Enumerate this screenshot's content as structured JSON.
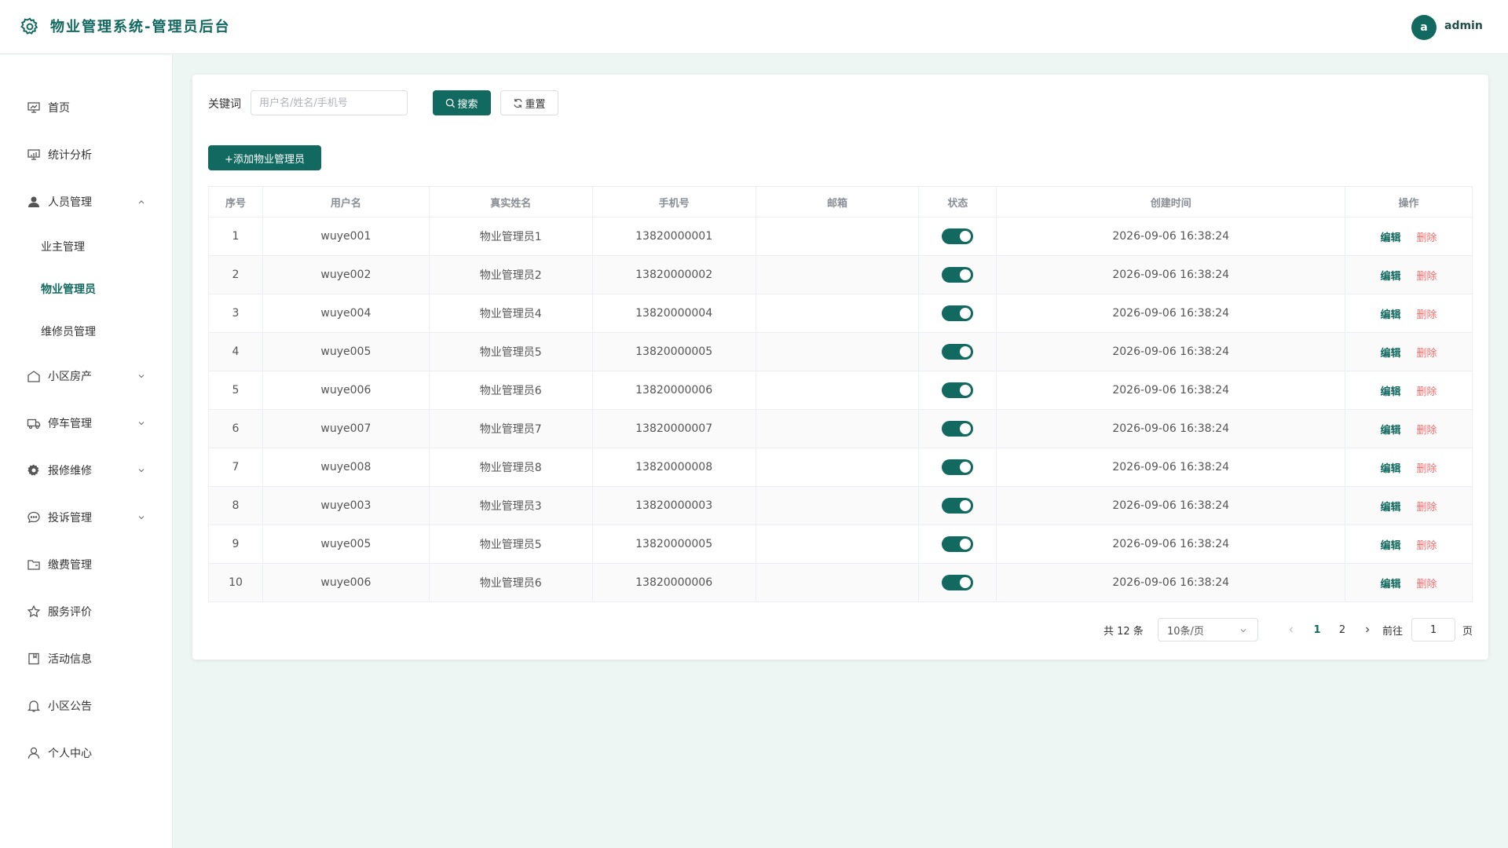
{
  "header": {
    "title": "物业管理系统-管理员后台",
    "avatar_letter": "a",
    "username": "admin"
  },
  "sidebar": {
    "items": [
      {
        "label": "首页",
        "icon": "dashboard-icon"
      },
      {
        "label": "统计分析",
        "icon": "chart-icon"
      },
      {
        "label": "人员管理",
        "icon": "user-filled-icon",
        "expanded": true,
        "children": [
          {
            "label": "业主管理"
          },
          {
            "label": "物业管理员",
            "active": true
          },
          {
            "label": "维修员管理"
          }
        ]
      },
      {
        "label": "小区房产",
        "icon": "house-icon"
      },
      {
        "label": "停车管理",
        "icon": "truck-icon"
      },
      {
        "label": "报修维修",
        "icon": "gear-icon"
      },
      {
        "label": "投诉管理",
        "icon": "chat-icon"
      },
      {
        "label": "缴费管理",
        "icon": "folder-icon"
      },
      {
        "label": "服务评价",
        "icon": "star-icon"
      },
      {
        "label": "活动信息",
        "icon": "notebook-icon"
      },
      {
        "label": "小区公告",
        "icon": "bell-icon"
      },
      {
        "label": "个人中心",
        "icon": "user-icon"
      }
    ]
  },
  "search": {
    "label": "关键词",
    "placeholder": "用户名/姓名/手机号",
    "value": "",
    "search_label": "搜索",
    "reset_label": "重置"
  },
  "toolbar": {
    "add_label": "+添加物业管理员"
  },
  "table": {
    "columns": [
      "序号",
      "用户名",
      "真实姓名",
      "手机号",
      "邮箱",
      "状态",
      "创建时间",
      "操作"
    ],
    "edit_label": "编辑",
    "delete_label": "删除",
    "rows": [
      {
        "no": "1",
        "username": "wuye001",
        "realname": "物业管理员1",
        "phone": "13820000001",
        "email": "",
        "enabled": true,
        "created": "2026-09-06 16:38:24"
      },
      {
        "no": "2",
        "username": "wuye002",
        "realname": "物业管理员2",
        "phone": "13820000002",
        "email": "",
        "enabled": true,
        "created": "2026-09-06 16:38:24"
      },
      {
        "no": "3",
        "username": "wuye004",
        "realname": "物业管理员4",
        "phone": "13820000004",
        "email": "",
        "enabled": true,
        "created": "2026-09-06 16:38:24"
      },
      {
        "no": "4",
        "username": "wuye005",
        "realname": "物业管理员5",
        "phone": "13820000005",
        "email": "",
        "enabled": true,
        "created": "2026-09-06 16:38:24"
      },
      {
        "no": "5",
        "username": "wuye006",
        "realname": "物业管理员6",
        "phone": "13820000006",
        "email": "",
        "enabled": true,
        "created": "2026-09-06 16:38:24"
      },
      {
        "no": "6",
        "username": "wuye007",
        "realname": "物业管理员7",
        "phone": "13820000007",
        "email": "",
        "enabled": true,
        "created": "2026-09-06 16:38:24"
      },
      {
        "no": "7",
        "username": "wuye008",
        "realname": "物业管理员8",
        "phone": "13820000008",
        "email": "",
        "enabled": true,
        "created": "2026-09-06 16:38:24"
      },
      {
        "no": "8",
        "username": "wuye003",
        "realname": "物业管理员3",
        "phone": "13820000003",
        "email": "",
        "enabled": true,
        "created": "2026-09-06 16:38:24"
      },
      {
        "no": "9",
        "username": "wuye005",
        "realname": "物业管理员5",
        "phone": "13820000005",
        "email": "",
        "enabled": true,
        "created": "2026-09-06 16:38:24"
      },
      {
        "no": "10",
        "username": "wuye006",
        "realname": "物业管理员6",
        "phone": "13820000006",
        "email": "",
        "enabled": true,
        "created": "2026-09-06 16:38:24"
      }
    ]
  },
  "pagination": {
    "total_label": "共 12 条",
    "page_size_label": "10条/页",
    "pages": [
      "1",
      "2"
    ],
    "current_page": "1",
    "goto_label": "前往",
    "goto_value": "1",
    "page_suffix": "页"
  },
  "colors": {
    "primary": "#11695f",
    "danger": "#f56c6c",
    "background": "#eef6f4"
  }
}
